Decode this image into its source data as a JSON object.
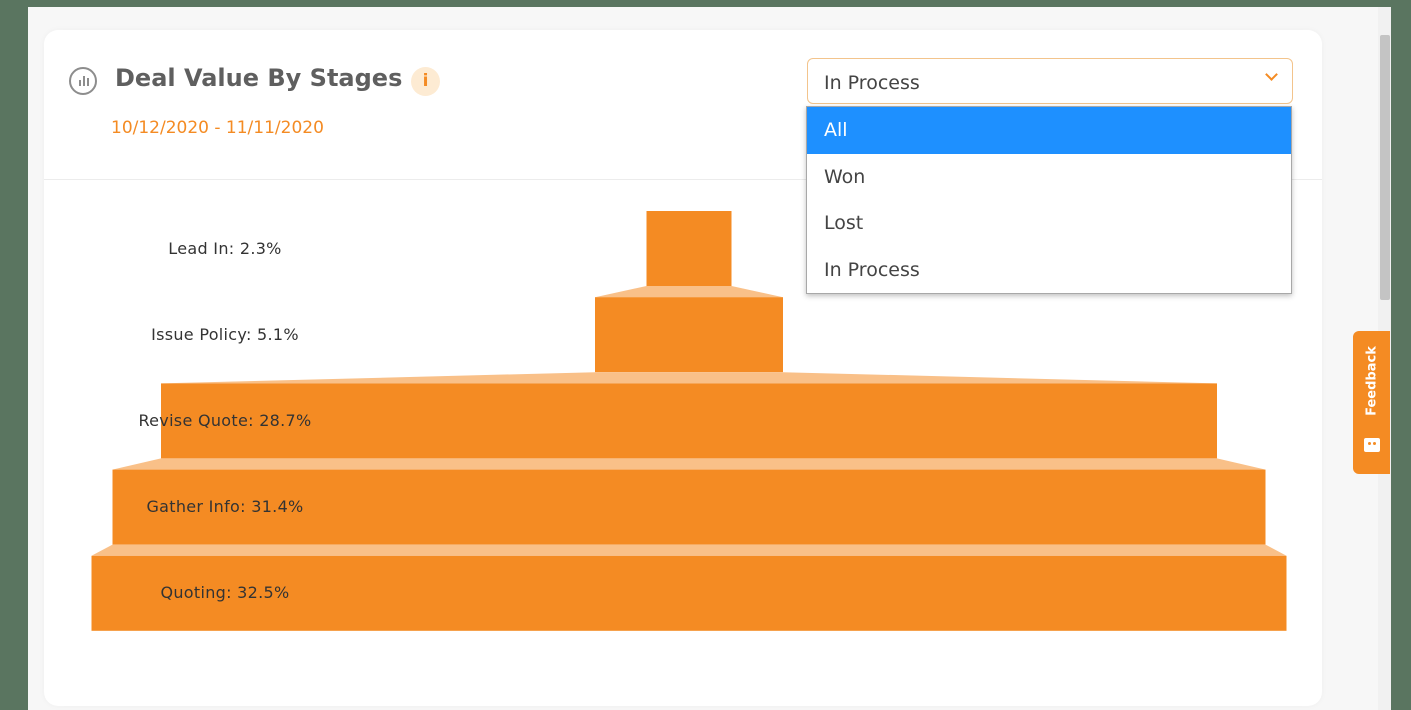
{
  "widget": {
    "title": "Deal Value By Stages",
    "info_icon": "i",
    "date_range": "10/12/2020 - 11/11/2020"
  },
  "filter": {
    "selected": "In Process",
    "options": [
      "All",
      "Won",
      "Lost",
      "In Process"
    ],
    "highlighted": "All"
  },
  "feedback": {
    "label": "Feedback"
  },
  "colors": {
    "accent": "#f48b23",
    "connector": "#f9c088",
    "highlight": "#1e90ff"
  },
  "chart_data": {
    "type": "funnel",
    "stages": [
      {
        "name": "Lead In",
        "percent": 2.3,
        "label": "Lead In: 2.3%"
      },
      {
        "name": "Issue Policy",
        "percent": 5.1,
        "label": "Issue Policy: 5.1%"
      },
      {
        "name": "Revise Quote",
        "percent": 28.7,
        "label": "Revise Quote: 28.7%"
      },
      {
        "name": "Gather Info",
        "percent": 31.4,
        "label": "Gather Info: 31.4%"
      },
      {
        "name": "Quoting",
        "percent": 32.5,
        "label": "Quoting: 32.5%"
      }
    ]
  }
}
